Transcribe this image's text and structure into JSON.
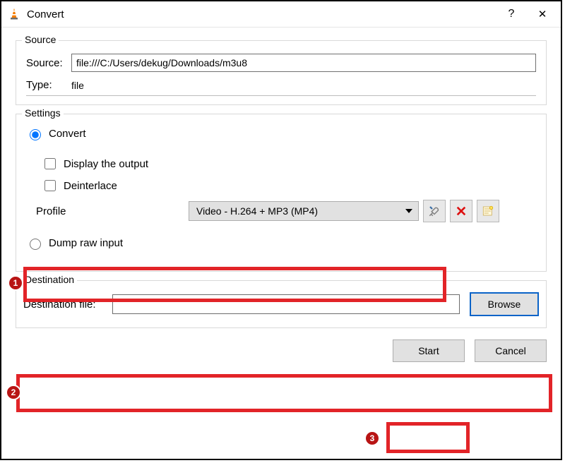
{
  "window": {
    "title": "Convert",
    "help_symbol": "?",
    "close_symbol": "✕"
  },
  "source": {
    "legend": "Source",
    "source_label": "Source:",
    "source_value": "file:///C:/Users/dekug/Downloads/m3u8",
    "type_label": "Type:",
    "type_value": "file"
  },
  "settings": {
    "legend": "Settings",
    "convert_label": "Convert",
    "display_output_label": "Display the output",
    "deinterlace_label": "Deinterlace",
    "profile_label": "Profile",
    "profile_selected": "Video - H.264 + MP3 (MP4)",
    "dump_label": "Dump raw input",
    "tool_edit_name": "wrench-screwdriver-icon",
    "tool_delete_name": "delete-x-icon",
    "tool_new_name": "new-profile-icon"
  },
  "destination": {
    "legend": "Destination",
    "file_label": "Destination file:",
    "file_value": "",
    "browse_label": "Browse"
  },
  "buttons": {
    "start": "Start",
    "cancel": "Cancel"
  },
  "annotations": {
    "n1": "1",
    "n2": "2",
    "n3": "3"
  }
}
